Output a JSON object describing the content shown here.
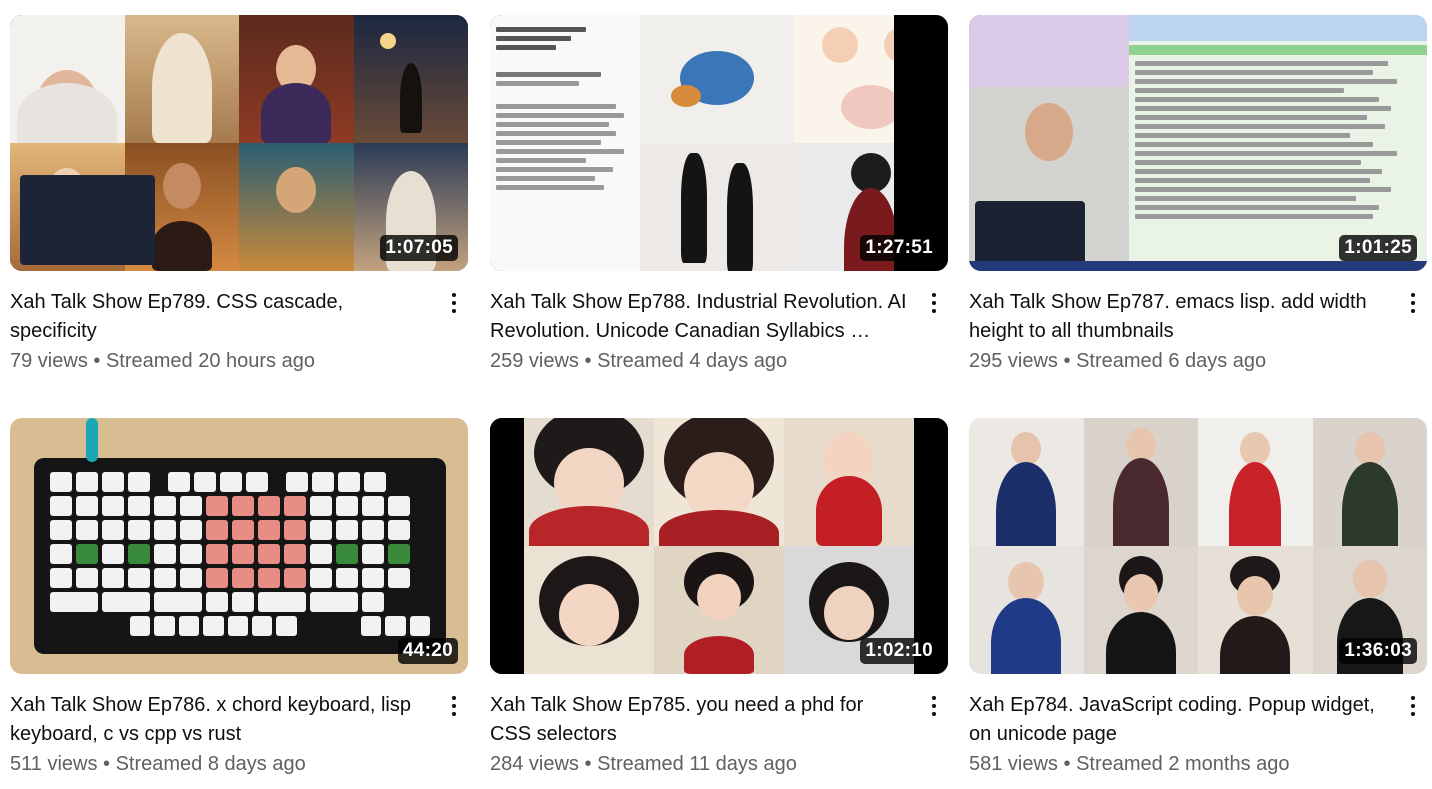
{
  "videos": [
    {
      "title": "Xah Talk Show Ep789. CSS cascade, specificity",
      "views": "79 views",
      "age": "Streamed 20 hours ago",
      "duration": "1:07:05"
    },
    {
      "title": "Xah Talk Show Ep788. Industrial Revolution. AI Revolution. Unicode Canadian Syllabics …",
      "views": "259 views",
      "age": "Streamed 4 days ago",
      "duration": "1:27:51"
    },
    {
      "title": "Xah Talk Show Ep787. emacs lisp. add width height to all thumbnails",
      "views": "295 views",
      "age": "Streamed 6 days ago",
      "duration": "1:01:25"
    },
    {
      "title": "Xah Talk Show Ep786. x chord keyboard, lisp keyboard, c vs cpp vs rust",
      "views": "511 views",
      "age": "Streamed 8 days ago",
      "duration": "44:20"
    },
    {
      "title": "Xah Talk Show Ep785. you need a phd for CSS selectors",
      "views": "284 views",
      "age": "Streamed 11 days ago",
      "duration": "1:02:10"
    },
    {
      "title": "Xah Ep784. JavaScript coding. Popup widget, on unicode page",
      "views": "581 views",
      "age": "Streamed 2 months ago",
      "duration": "1:36:03"
    }
  ],
  "stats_separator": " • ",
  "icons": {
    "more": "more-vert-icon"
  },
  "colors": {
    "title": "#0f0f0f",
    "meta": "#606060",
    "duration_bg": "#000000cc"
  }
}
